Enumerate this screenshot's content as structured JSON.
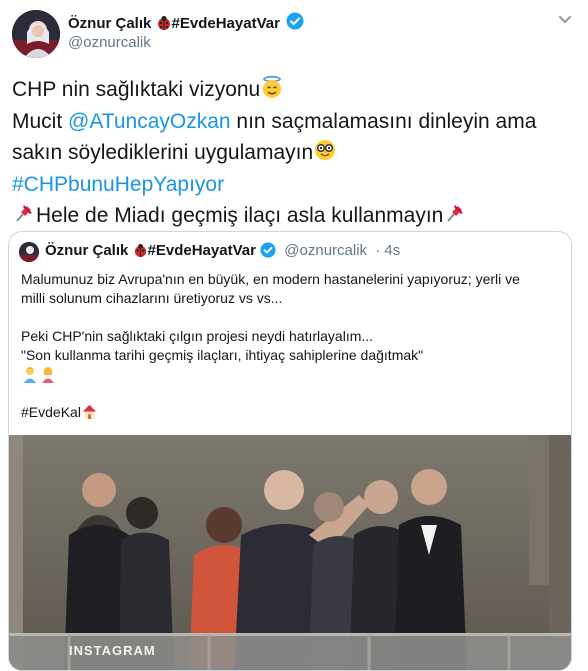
{
  "author": {
    "name": "Öznur Çalık",
    "hashtag_name": "#EvdeHayatVar",
    "handle": "@oznurcalik"
  },
  "tweet": {
    "line1_text": "CHP nin sağlıktaki vizyonu",
    "line2_prefix": "Mucit ",
    "line2_mention": "@ATuncayOzkan",
    "line2_suffix": " nın saçmalamasını dinleyin ama",
    "line3_text": "sakın söylediklerini uygulamayın",
    "line4_hashtag": "#CHPbunuHepYapıyor",
    "line5_text": "Hele de Miadı geçmiş ilaçı asla  kullanmayın"
  },
  "quoted": {
    "name": "Öznur Çalık",
    "hashtag_name": "#EvdeHayatVar",
    "handle": "@oznurcalik",
    "time": "· 4s",
    "text_lines": [
      "Malumunuz biz Avrupa'nın en büyük, en modern hastanelerini yapıyoruz; yerli ve",
      "milli solunum cihazlarını üretiyoruz vs vs...",
      "",
      "Peki CHP'nin sağlıktaki çılgın projesi neydi hatırlayalım...",
      "\"Son kullanma tarihi geçmiş ilaçları, ihtiyaç sahiplerine dağıtmak\"",
      "",
      "",
      "#EvdeKal"
    ],
    "video_watermark": "INSTAGRAM"
  },
  "colors": {
    "link": "#1b95e0",
    "secondary_text": "#657786",
    "border": "#ccd6dd",
    "verified": "#1da1f2"
  },
  "icons": [
    "ladybug-icon",
    "verified-badge-icon",
    "chevron-down-icon",
    "halo-face-icon",
    "nerd-face-icon",
    "pushpin-icon",
    "person-emoji-icon",
    "house-icon"
  ]
}
